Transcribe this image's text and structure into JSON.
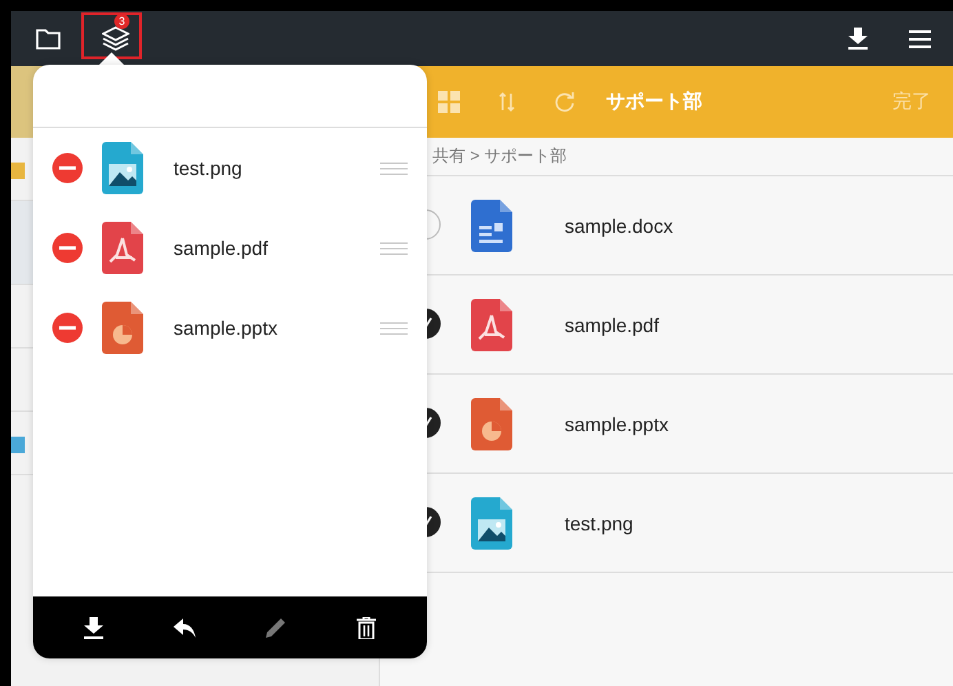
{
  "top_bar": {
    "badge": "3",
    "annotation_frame": true
  },
  "toolbar": {
    "title": "サポート部",
    "done_label": "完了"
  },
  "breadcrumb": "共有 > サポート部",
  "files": [
    {
      "name": "sample.docx",
      "kind": "docx",
      "selected": false
    },
    {
      "name": "sample.pdf",
      "kind": "pdf",
      "selected": true
    },
    {
      "name": "sample.pptx",
      "kind": "pptx",
      "selected": true
    },
    {
      "name": "test.png",
      "kind": "png",
      "selected": true
    }
  ],
  "popover": {
    "items": [
      {
        "name": "test.png",
        "kind": "png"
      },
      {
        "name": "sample.pdf",
        "kind": "pdf"
      },
      {
        "name": "sample.pptx",
        "kind": "pptx"
      }
    ]
  }
}
